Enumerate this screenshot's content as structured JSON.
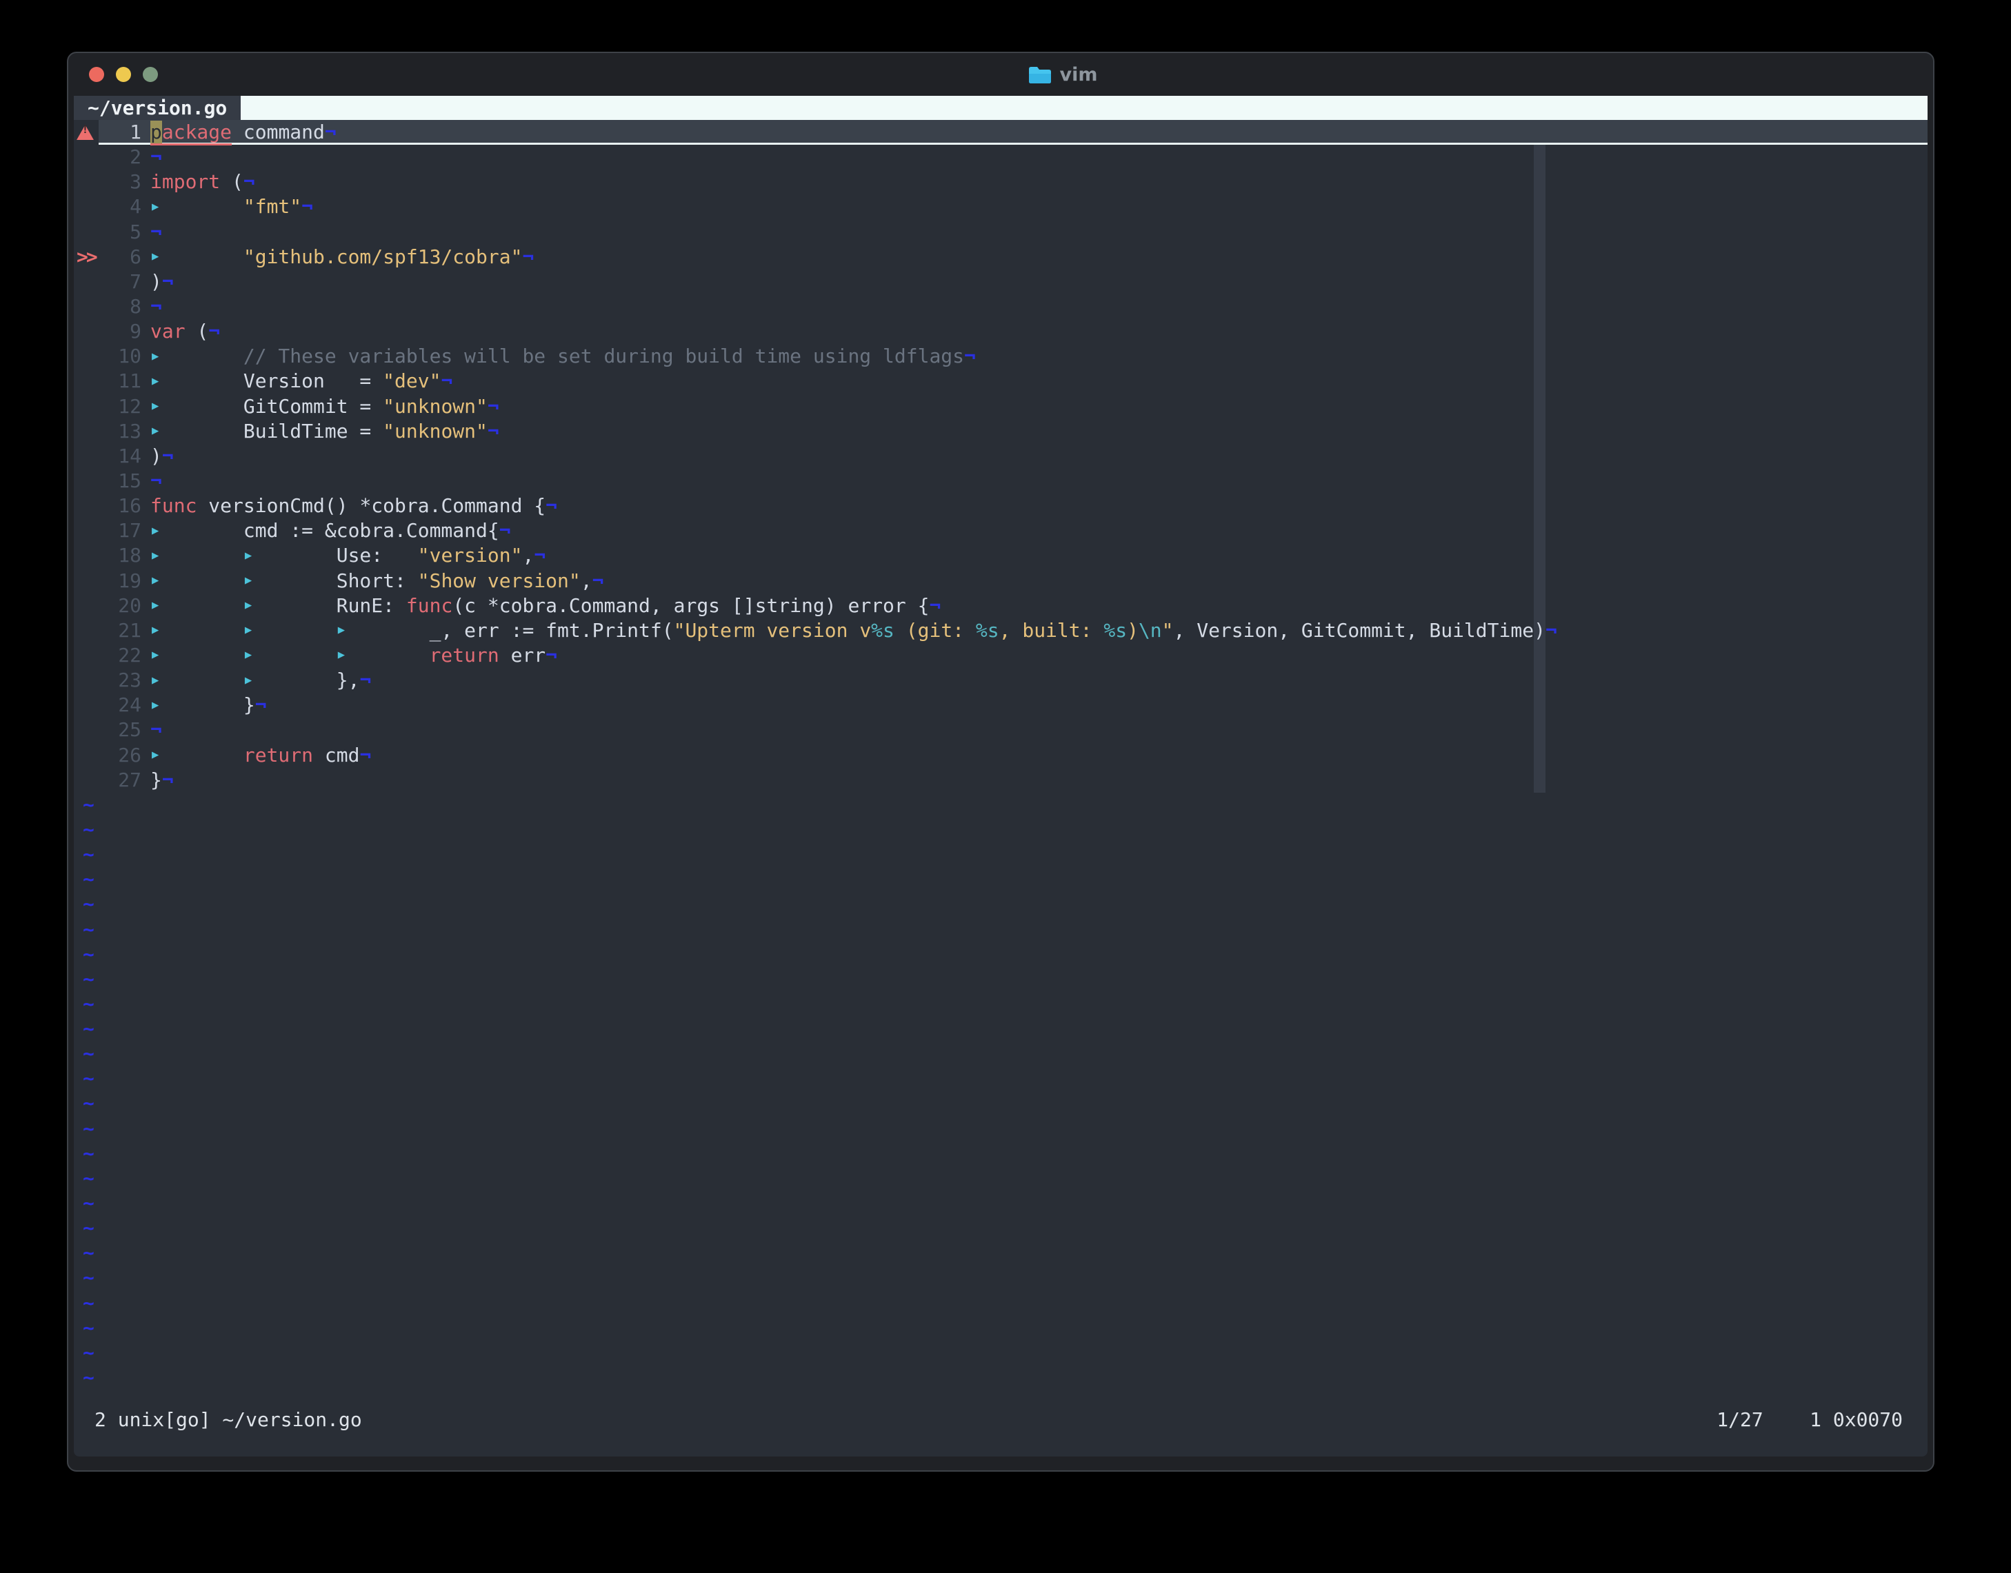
{
  "window": {
    "title": "vim"
  },
  "tabbar": {
    "active_tab": "~/version.go"
  },
  "colors": {
    "background": "#292e36",
    "chrome": "#202226",
    "tab_fill": "#f0faf9",
    "keyword": "#e06c75",
    "string": "#e5c07b",
    "format_spec": "#56b6c2",
    "text": "#d5dbe5",
    "comment": "#6a7380",
    "line_number": "#4d5663",
    "eol_marker": "#2a30e0",
    "cursor": "#9a9158",
    "cursorline_bg": "#3a414b",
    "sign_warning": "#ed6f6e",
    "traffic_red": "#ed6a5f",
    "traffic_yellow": "#eec94f",
    "traffic_green": "#7d9b80",
    "folder_icon": "#45c4ee"
  },
  "editor": {
    "eol_char": "¬",
    "tilde_char": "~",
    "tab_marker": "▶",
    "lines": [
      {
        "num": "1",
        "sign": "warning",
        "cursorline": true,
        "segs": [
          {
            "t": "p",
            "c": "kw err cursor"
          },
          {
            "t": "ackage",
            "c": "kw err"
          },
          {
            "t": " command",
            "c": "txt"
          }
        ]
      },
      {
        "num": "2",
        "segs": []
      },
      {
        "num": "3",
        "segs": [
          {
            "t": "import",
            "c": "kw"
          },
          {
            "t": " (",
            "c": "txt"
          }
        ]
      },
      {
        "num": "4",
        "segs": [
          {
            "t": "tab"
          },
          {
            "t": "\"fmt\"",
            "c": "str"
          }
        ]
      },
      {
        "num": "5",
        "segs": []
      },
      {
        "num": "6",
        "sign": "chevrons",
        "segs": [
          {
            "t": "tab"
          },
          {
            "t": "\"github.com/spf13/cobra\"",
            "c": "str"
          }
        ]
      },
      {
        "num": "7",
        "segs": [
          {
            "t": ")",
            "c": "txt"
          }
        ]
      },
      {
        "num": "8",
        "segs": []
      },
      {
        "num": "9",
        "segs": [
          {
            "t": "var",
            "c": "kw"
          },
          {
            "t": " (",
            "c": "txt"
          }
        ]
      },
      {
        "num": "10",
        "segs": [
          {
            "t": "tab"
          },
          {
            "t": "// These variables will be set during build time using ldflags",
            "c": "cmt"
          }
        ]
      },
      {
        "num": "11",
        "segs": [
          {
            "t": "tab"
          },
          {
            "t": "Version   = ",
            "c": "txt"
          },
          {
            "t": "\"dev\"",
            "c": "str"
          }
        ]
      },
      {
        "num": "12",
        "segs": [
          {
            "t": "tab"
          },
          {
            "t": "GitCommit = ",
            "c": "txt"
          },
          {
            "t": "\"unknown\"",
            "c": "str"
          }
        ]
      },
      {
        "num": "13",
        "segs": [
          {
            "t": "tab"
          },
          {
            "t": "BuildTime = ",
            "c": "txt"
          },
          {
            "t": "\"unknown\"",
            "c": "str"
          }
        ]
      },
      {
        "num": "14",
        "segs": [
          {
            "t": ")",
            "c": "txt"
          }
        ]
      },
      {
        "num": "15",
        "segs": []
      },
      {
        "num": "16",
        "segs": [
          {
            "t": "func",
            "c": "kw"
          },
          {
            "t": " versionCmd() *cobra.Command {",
            "c": "txt"
          }
        ]
      },
      {
        "num": "17",
        "segs": [
          {
            "t": "tab"
          },
          {
            "t": "cmd := &cobra.Command{",
            "c": "txt"
          }
        ]
      },
      {
        "num": "18",
        "segs": [
          {
            "t": "tab"
          },
          {
            "t": "tab"
          },
          {
            "t": "Use:   ",
            "c": "txt"
          },
          {
            "t": "\"version\"",
            "c": "str"
          },
          {
            "t": ",",
            "c": "txt"
          }
        ]
      },
      {
        "num": "19",
        "segs": [
          {
            "t": "tab"
          },
          {
            "t": "tab"
          },
          {
            "t": "Short: ",
            "c": "txt"
          },
          {
            "t": "\"Show version\"",
            "c": "str"
          },
          {
            "t": ",",
            "c": "txt"
          }
        ]
      },
      {
        "num": "20",
        "segs": [
          {
            "t": "tab"
          },
          {
            "t": "tab"
          },
          {
            "t": "RunE: ",
            "c": "txt"
          },
          {
            "t": "func",
            "c": "kw"
          },
          {
            "t": "(c *cobra.Command, args []string) error {",
            "c": "txt"
          }
        ]
      },
      {
        "num": "21",
        "segs": [
          {
            "t": "tab"
          },
          {
            "t": "tab"
          },
          {
            "t": "tab"
          },
          {
            "t": "_, err := fmt.Printf(",
            "c": "txt"
          },
          {
            "t": "\"Upterm version v",
            "c": "str"
          },
          {
            "t": "%s",
            "c": "fmt"
          },
          {
            "t": " (git: ",
            "c": "str"
          },
          {
            "t": "%s",
            "c": "fmt"
          },
          {
            "t": ", built: ",
            "c": "str"
          },
          {
            "t": "%s",
            "c": "fmt"
          },
          {
            "t": ")",
            "c": "str"
          },
          {
            "t": "\\n",
            "c": "fmt"
          },
          {
            "t": "\"",
            "c": "str"
          },
          {
            "t": ", Version, GitCommit, BuildTime)",
            "c": "txt"
          }
        ]
      },
      {
        "num": "22",
        "segs": [
          {
            "t": "tab"
          },
          {
            "t": "tab"
          },
          {
            "t": "tab"
          },
          {
            "t": "return",
            "c": "kw"
          },
          {
            "t": " err",
            "c": "txt"
          }
        ]
      },
      {
        "num": "23",
        "segs": [
          {
            "t": "tab"
          },
          {
            "t": "tab"
          },
          {
            "t": "},",
            "c": "txt"
          }
        ]
      },
      {
        "num": "24",
        "segs": [
          {
            "t": "tab"
          },
          {
            "t": "}",
            "c": "txt"
          }
        ]
      },
      {
        "num": "25",
        "segs": []
      },
      {
        "num": "26",
        "segs": [
          {
            "t": "tab"
          },
          {
            "t": "return",
            "c": "kw"
          },
          {
            "t": " cmd",
            "c": "txt"
          }
        ]
      },
      {
        "num": "27",
        "segs": [
          {
            "t": "}",
            "c": "txt"
          }
        ]
      }
    ]
  },
  "statusbar": {
    "left": "2 unix[go] ~/version.go",
    "right": "1/27    1 0x0070"
  }
}
